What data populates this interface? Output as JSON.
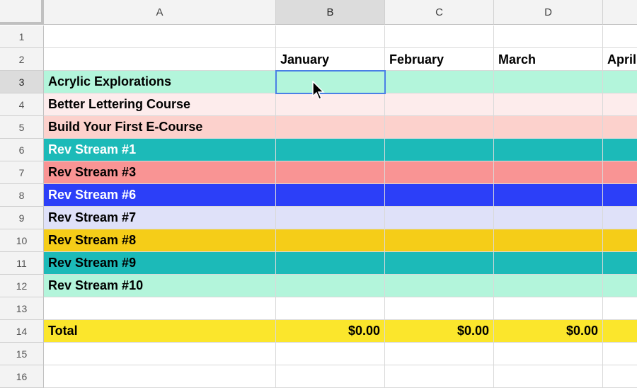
{
  "columns": [
    "A",
    "B",
    "C",
    "D",
    ""
  ],
  "row_numbers": [
    "1",
    "2",
    "3",
    "4",
    "5",
    "6",
    "7",
    "8",
    "9",
    "10",
    "11",
    "12",
    "13",
    "14",
    "15",
    "16"
  ],
  "selected_cell": "B3",
  "rows": [
    {
      "fill": "#ffffff",
      "text_color": "#000000",
      "cells": [
        "",
        "",
        "",
        "",
        ""
      ]
    },
    {
      "fill": "#ffffff",
      "text_color": "#000000",
      "cells": [
        "",
        "January",
        "February",
        "March",
        "April"
      ]
    },
    {
      "fill": "#b3f5db",
      "text_color": "#000000",
      "cells": [
        "Acrylic Explorations",
        "",
        "",
        "",
        ""
      ]
    },
    {
      "fill": "#fdecec",
      "text_color": "#000000",
      "cells": [
        "Better Lettering Course",
        "",
        "",
        "",
        ""
      ]
    },
    {
      "fill": "#fcd1cc",
      "text_color": "#000000",
      "cells": [
        "Build Your First E-Course",
        "",
        "",
        "",
        ""
      ]
    },
    {
      "fill": "#1cbab8",
      "text_color": "#ffffff",
      "cells": [
        "Rev Stream #1",
        "",
        "",
        "",
        ""
      ]
    },
    {
      "fill": "#f99494",
      "text_color": "#000000",
      "cells": [
        "Rev Stream #3",
        "",
        "",
        "",
        ""
      ]
    },
    {
      "fill": "#2c3ff8",
      "text_color": "#ffffff",
      "cells": [
        "Rev Stream #6",
        "",
        "",
        "",
        ""
      ]
    },
    {
      "fill": "#dfe1f9",
      "text_color": "#000000",
      "cells": [
        "Rev Stream #7",
        "",
        "",
        "",
        ""
      ]
    },
    {
      "fill": "#f5cd18",
      "text_color": "#000000",
      "cells": [
        "Rev Stream #8",
        "",
        "",
        "",
        ""
      ]
    },
    {
      "fill": "#1cbab8",
      "text_color": "#000000",
      "cells": [
        "Rev Stream #9",
        "",
        "",
        "",
        ""
      ]
    },
    {
      "fill": "#b3f5db",
      "text_color": "#000000",
      "cells": [
        "Rev Stream #10",
        "",
        "",
        "",
        ""
      ]
    },
    {
      "fill": "#ffffff",
      "text_color": "#000000",
      "cells": [
        "",
        "",
        "",
        "",
        ""
      ]
    },
    {
      "fill": "#fbe62c",
      "text_color": "#000000",
      "cells": [
        "Total",
        "$0.00",
        "$0.00",
        "$0.00",
        ""
      ]
    },
    {
      "fill": "#ffffff",
      "text_color": "#000000",
      "cells": [
        "",
        "",
        "",
        "",
        ""
      ]
    },
    {
      "fill": "#ffffff",
      "text_color": "#000000",
      "cells": [
        "",
        "",
        "",
        "",
        ""
      ]
    }
  ]
}
